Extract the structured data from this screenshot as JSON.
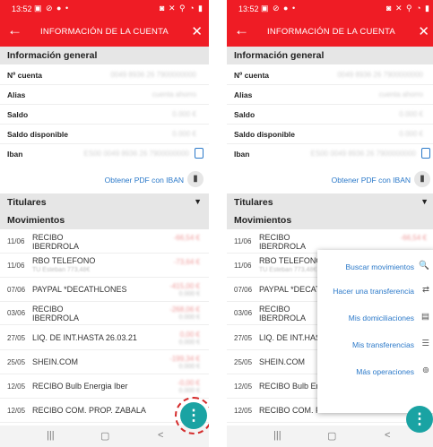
{
  "status_bar": {
    "time": "13:52",
    "left_icons": "▣ ⊘ ●  •",
    "right_icons": "◙ ✕ ⚲ ◔ ▮"
  },
  "header": {
    "title": "INFORMACIÓN DE LA CUENTA",
    "back_icon": "arrow-left-icon",
    "close_icon": "close-icon"
  },
  "info": {
    "section_title": "Información general",
    "rows": [
      {
        "label": "Nº cuenta",
        "value": "0049 8936 26 7900000000"
      },
      {
        "label": "Alias",
        "value": "cuenta ahorro"
      },
      {
        "label": "Saldo",
        "value": "0.000 €"
      },
      {
        "label": "Saldo disponible",
        "value": "0.000 €"
      },
      {
        "label": "Iban",
        "value": "ES00 0049 8936 26 7900000000"
      }
    ],
    "pdf_link": "Obtener PDF con IBAN"
  },
  "titulares": {
    "title": "Titulares",
    "caret": "▼"
  },
  "movimientos": {
    "title": "Movimientos",
    "rows": [
      {
        "date": "11/06",
        "desc": "RECIBO\nIBERDROLA",
        "sub": "",
        "amount": "-66,54 €",
        "balance": ""
      },
      {
        "date": "11/06",
        "desc": "RBO TELEFONO",
        "sub": "TU Esteban 773,48€",
        "amount": "-73,64 €",
        "balance": ""
      },
      {
        "date": "07/06",
        "desc": "PAYPAL *DECATHLONES",
        "sub": "",
        "amount": "-415,00 €",
        "balance": "0.000 €"
      },
      {
        "date": "03/06",
        "desc": "RECIBO\nIBERDROLA",
        "sub": "",
        "amount": "-268,06 €",
        "balance": "0.000 €"
      },
      {
        "date": "27/05",
        "desc": "LIQ. DE INT.HASTA 26.03.21",
        "sub": "",
        "amount": "0,00 €",
        "balance": "0.000 €"
      },
      {
        "date": "25/05",
        "desc": "SHEIN.COM",
        "sub": "",
        "amount": "-199,34 €",
        "balance": "0.000 €"
      },
      {
        "date": "12/05",
        "desc": "RECIBO Bulb Energia Iber",
        "sub": "",
        "amount": "-0,00 €",
        "balance": "0.000 €"
      },
      {
        "date": "12/05",
        "desc": "RECIBO COM. PROP. ZABALA",
        "sub": "",
        "amount": "",
        "balance": ""
      }
    ]
  },
  "fab": {
    "icon": "more-vertical-icon",
    "glyph": "⋮"
  },
  "popup": {
    "items": [
      {
        "label": "Buscar movimientos",
        "icon": "search-icon",
        "glyph": "🔍"
      },
      {
        "label": "Hacer una transferencia",
        "icon": "transfer-icon",
        "glyph": "⇄"
      },
      {
        "label": "Mis domiciliaciones",
        "icon": "document-icon",
        "glyph": "▤"
      },
      {
        "label": "Mis transferencias",
        "icon": "list-icon",
        "glyph": "☰"
      },
      {
        "label": "Más operaciones",
        "icon": "more-circle-icon",
        "glyph": "⊚"
      }
    ]
  },
  "nav": {
    "recents": "|||",
    "home": "▢",
    "back": "<"
  }
}
